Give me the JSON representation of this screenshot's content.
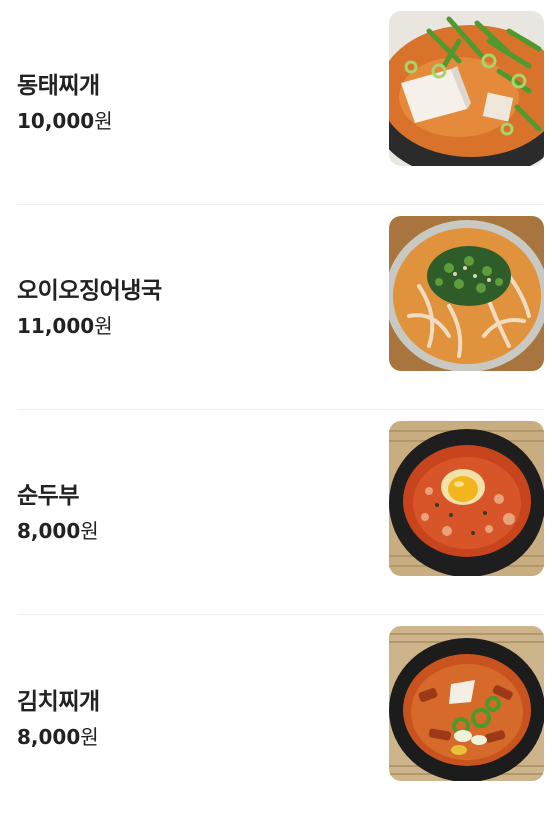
{
  "menu": [
    {
      "name": "동태찌개",
      "price": "10,000",
      "unit": "원",
      "photo": "dongtae-jjigae-photo"
    },
    {
      "name": "오이오징어냉국",
      "price": "11,000",
      "unit": "원",
      "photo": "oi-ojingeo-naengguk-photo"
    },
    {
      "name": "순두부",
      "price": "8,000",
      "unit": "원",
      "photo": "sundubu-photo"
    },
    {
      "name": "김치찌개",
      "price": "8,000",
      "unit": "원",
      "photo": "kimchi-jjigae-photo"
    }
  ]
}
